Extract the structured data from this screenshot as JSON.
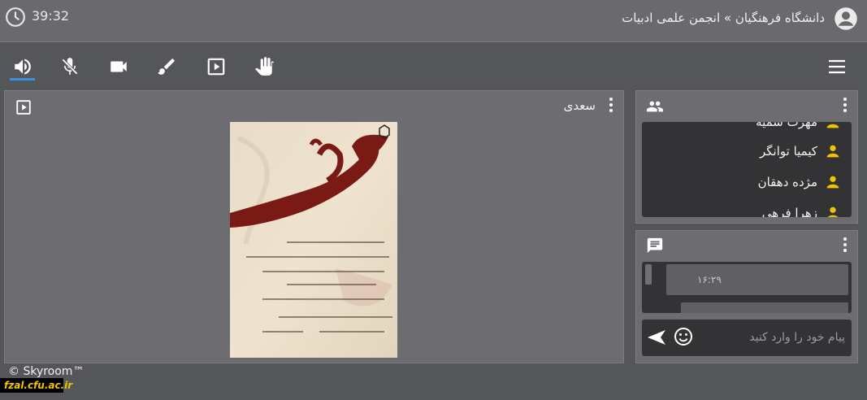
{
  "header": {
    "timer": "39:32",
    "breadcrumb": "دانشگاه فرهنگیان » انجمن علمی ادبیات"
  },
  "toolbar": {
    "tools": [
      "speaker-icon",
      "mic-off-icon",
      "camera-icon",
      "brush-icon",
      "media-play-icon",
      "raise-hand-icon"
    ],
    "active": "speaker-icon"
  },
  "presentation": {
    "title": "سعدی"
  },
  "users": {
    "items": [
      {
        "name": "مهرت سمیه"
      },
      {
        "name": "کیمیا توانگر"
      },
      {
        "name": "مژده دهقان"
      },
      {
        "name": "زهرا فرهی"
      }
    ]
  },
  "chat": {
    "messages": [
      {
        "time": "۱۶:۲۹"
      }
    ],
    "input_placeholder": "پیام خود را وارد کنید"
  },
  "footer": {
    "brand": "© Skyroom™",
    "badge": "fzal.cfu.ac.ir"
  },
  "colors": {
    "accent": "#3b8fe0",
    "user_icon": "#f0c400"
  }
}
